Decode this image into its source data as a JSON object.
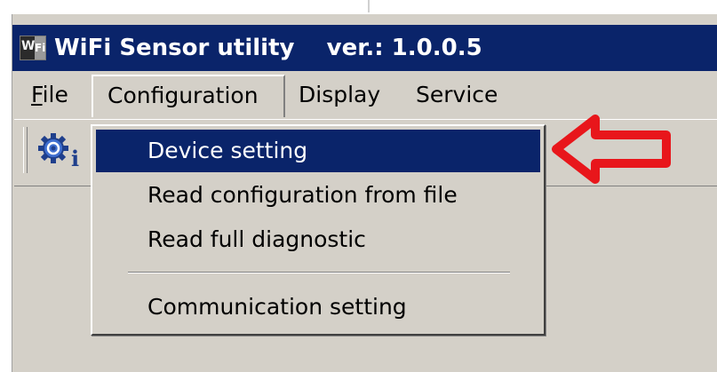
{
  "window": {
    "title": "WiFi Sensor utility    ver.: 1.0.0.5",
    "icon": "wifi-sensor-app-icon",
    "icon_text_left": "Wi",
    "icon_text_right": "Fi"
  },
  "menubar": {
    "file": {
      "underlined": "F",
      "rest": "ile"
    },
    "configuration": "Configuration",
    "display": "Display",
    "service": "Service"
  },
  "toolbar": {
    "device_settings_icon": "gear-info-icon"
  },
  "configuration_menu": {
    "items": [
      {
        "label": "Device setting",
        "selected": true
      },
      {
        "label": "Read configuration from file",
        "selected": false
      },
      {
        "label": "Read full diagnostic",
        "selected": false
      },
      {
        "label": "Communication setting",
        "selected": false
      }
    ]
  },
  "annotation": {
    "arrow_color": "#e8161b",
    "arrow_direction": "left"
  },
  "colors": {
    "title_bar": "#0a246a",
    "face": "#d4d0c8",
    "highlight_text": "#ffffff"
  }
}
